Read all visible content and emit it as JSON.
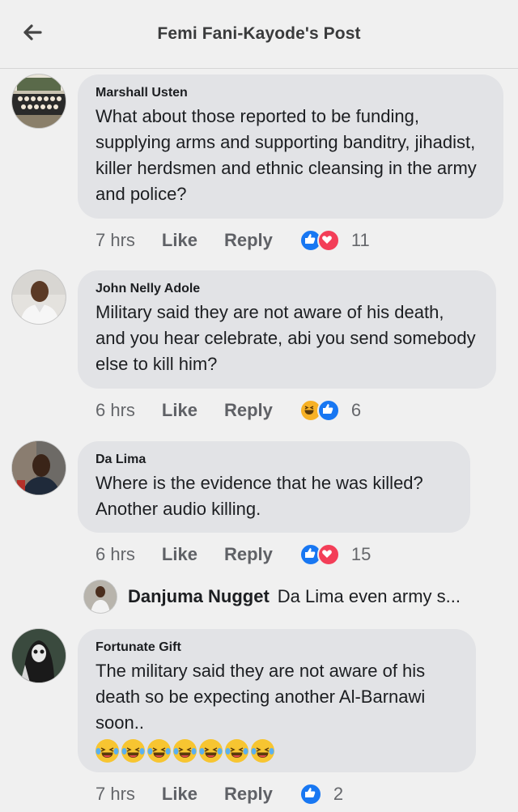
{
  "header": {
    "title": "Femi Fani-Kayode's Post",
    "back_icon": "arrow-left-icon"
  },
  "comments": [
    {
      "author": "Marshall Usten",
      "text": "What about those reported to be funding, supplying arms and supporting banditry, jihadist, killer herdsmen and ethnic cleansing in the army and police?",
      "time": "7 hrs",
      "like": "Like",
      "reply": "Reply",
      "reactions": [
        "like",
        "love"
      ],
      "count": "11"
    },
    {
      "author": "John Nelly Adole",
      "text": "Military said they are not aware of his death, and you hear celebrate, abi you send somebody else to kill him?",
      "time": "6 hrs",
      "like": "Like",
      "reply": "Reply",
      "reactions": [
        "haha",
        "like"
      ],
      "count": "6"
    },
    {
      "author": "Da Lima",
      "text": "Where is the evidence that he was killed? Another audio killing.",
      "time": "6 hrs",
      "like": "Like",
      "reply": "Reply",
      "reactions": [
        "like",
        "love"
      ],
      "count": "15"
    },
    {
      "author": "Fortunate Gift",
      "text": "The military said they are not aware of his death so be expecting another Al-Barnawi soon..",
      "emoji_count": 7,
      "time": "7 hrs",
      "like": "Like",
      "reply": "Reply",
      "reactions": [
        "like"
      ],
      "count": "2"
    }
  ],
  "reply_preview": {
    "author": "Danjuma Nugget",
    "text": "Da Lima even army s..."
  },
  "colors": {
    "like": "#1877f2",
    "love": "#f33e58",
    "haha": "#f7b125",
    "bubble": "#e2e3e6"
  }
}
